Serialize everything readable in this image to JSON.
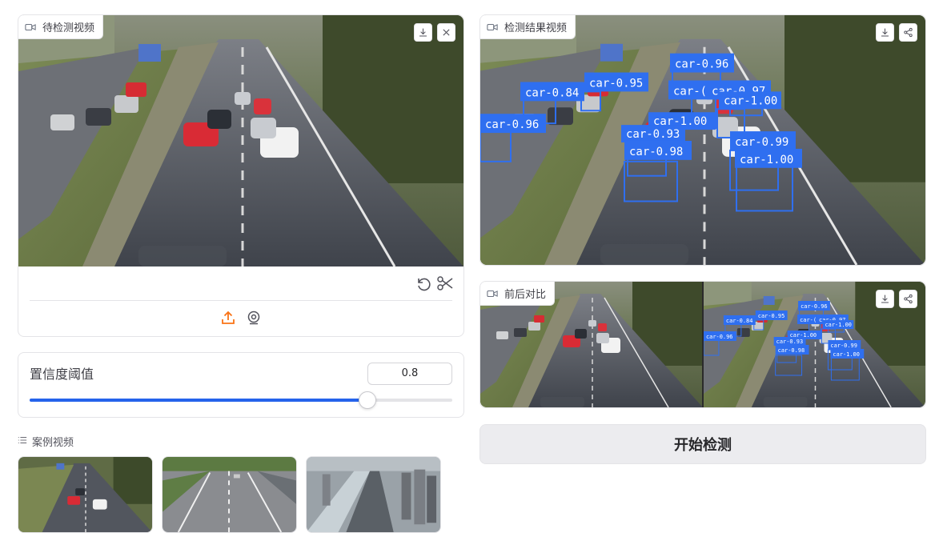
{
  "input_video": {
    "label": "待检测视频",
    "actions": [
      "download-icon",
      "close-icon"
    ],
    "tools": [
      "undo-icon",
      "scissors-icon"
    ],
    "sources": [
      "upload-icon",
      "webcam-icon"
    ]
  },
  "result_video": {
    "label": "检测结果视频",
    "actions": [
      "download-icon",
      "share-icon"
    ],
    "detections": [
      "car-0.96",
      "car-0.84",
      "car-0.95",
      "car-(",
      "car-0.97",
      "car-1.00",
      "car-0.96",
      "car-1.00",
      "car-0.93",
      "car-0.98",
      "car-0.99",
      "car-1.00"
    ]
  },
  "compare_video": {
    "label": "前后对比",
    "actions": [
      "download-icon",
      "share-icon"
    ],
    "detections": [
      "car-0.96",
      "car-0.84",
      "car-0.95",
      "car-(",
      "car-0.97",
      "car-1.00",
      "car-0.96",
      "car-1.00",
      "car-0.93",
      "car-0.98",
      "car-0.99",
      "car-1.00"
    ]
  },
  "confidence": {
    "label": "置信度阈值",
    "value": "0.8",
    "fraction": 0.8
  },
  "examples": {
    "label": "案例视频",
    "items": [
      "highway-traffic",
      "motorway-overhead",
      "city-river-road"
    ]
  },
  "start_button": "开始检测",
  "colors": {
    "accent": "#2563eb",
    "upload_orange": "#f97316",
    "box_blue": "#2f6ff0"
  }
}
